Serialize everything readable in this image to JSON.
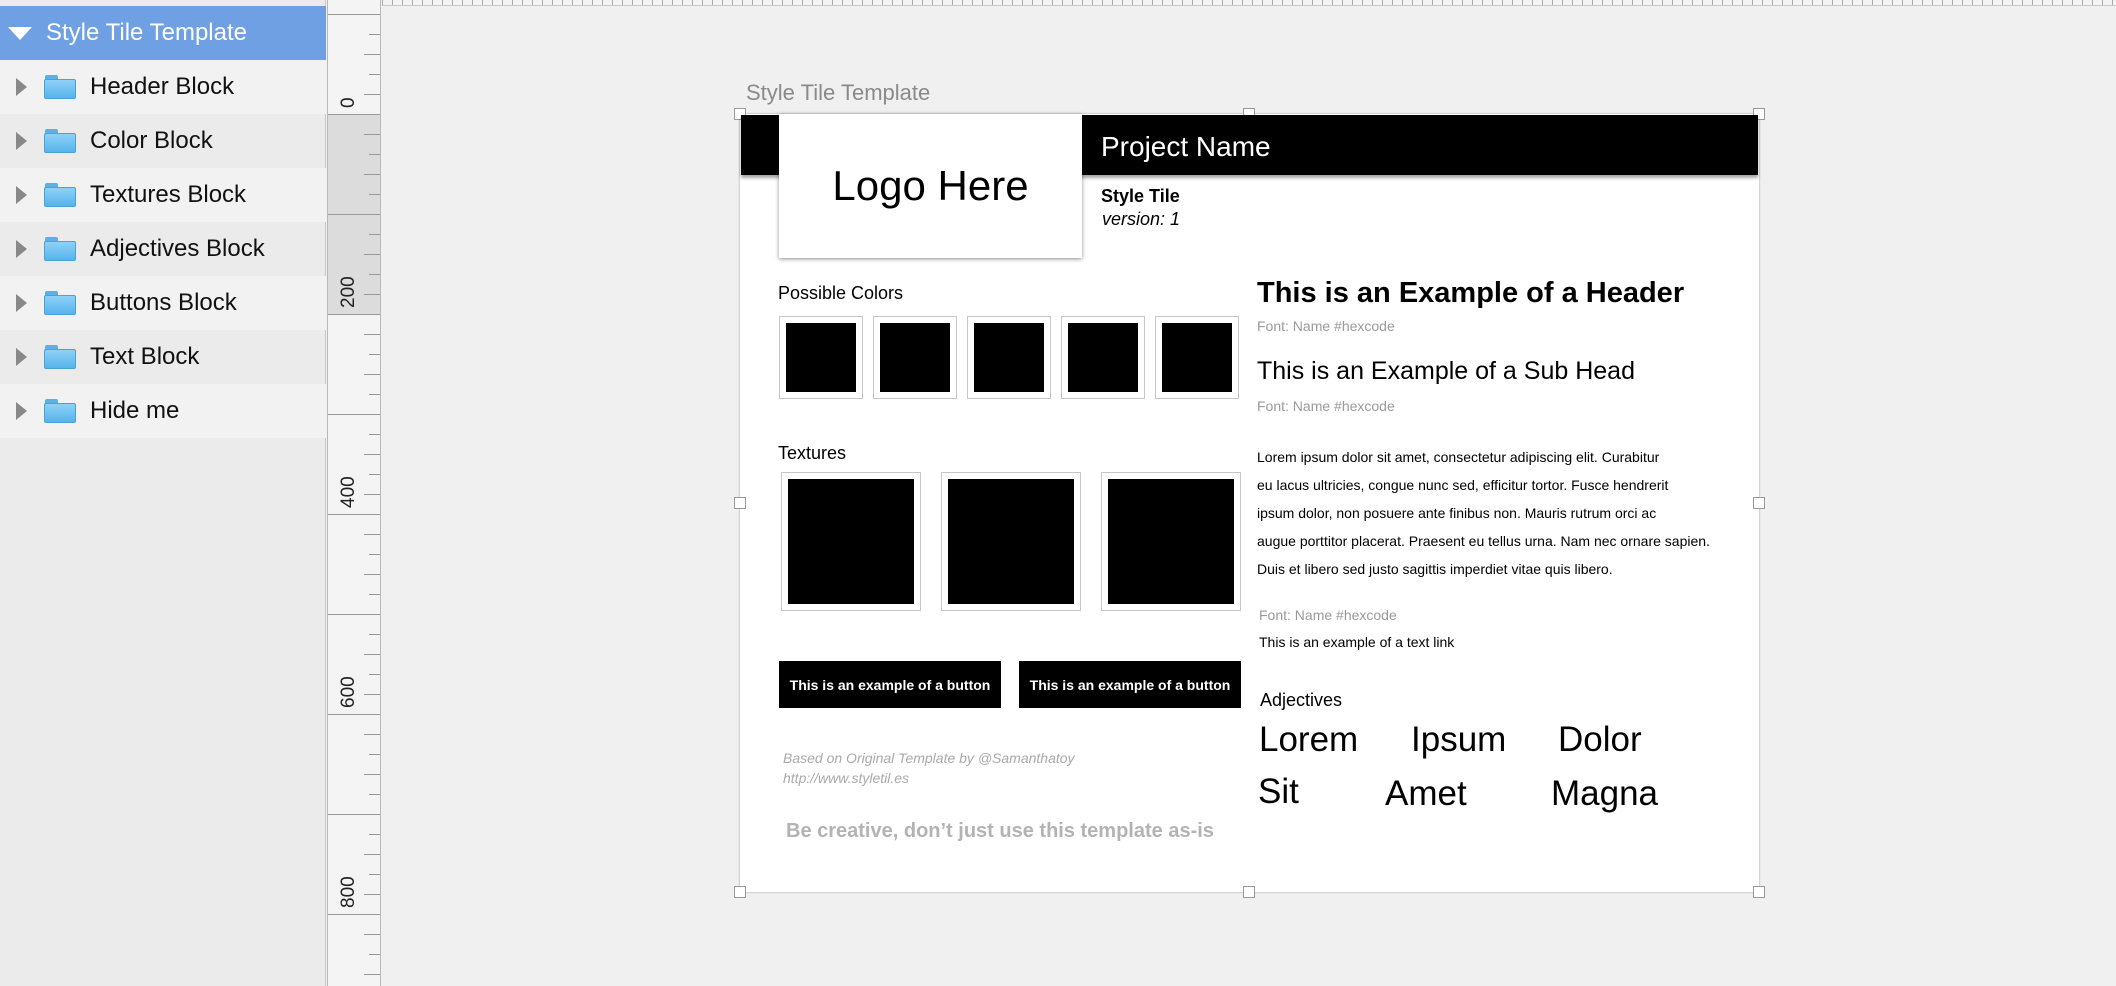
{
  "sidebar": {
    "root_label": "Style Tile Template",
    "items": [
      {
        "label": "Header Block"
      },
      {
        "label": "Color Block"
      },
      {
        "label": "Textures Block"
      },
      {
        "label": "Adjectives Block"
      },
      {
        "label": "Buttons Block"
      },
      {
        "label": "Text Block"
      },
      {
        "label": "Hide me"
      }
    ]
  },
  "ruler": {
    "labels": [
      "0",
      "200",
      "400",
      "600",
      "800"
    ]
  },
  "artboard": {
    "title": "Style Tile Template",
    "project_name": "Project Name",
    "logo_text": "Logo Here",
    "style_tile_label": "Style Tile",
    "version_label": "version: 1",
    "colors_label": "Possible Colors",
    "swatch_colors": [
      "#000000",
      "#000000",
      "#000000",
      "#000000",
      "#000000"
    ],
    "textures_label": "Textures",
    "buttons": [
      "This is an example of a button",
      "This is an example of a button"
    ],
    "credit_line1": "Based on Original Template by @Samanthatoy",
    "credit_line2": "http://www.styletil.es",
    "be_creative": "Be creative, don’t just use this template as-is",
    "header_example": "This is an Example of a Header",
    "header_font": "Font: Name #hexcode",
    "subhead_example": "This is an Example of a Sub Head",
    "subhead_font": "Font: Name #hexcode",
    "body_lines": [
      "Lorem ipsum dolor sit amet, consectetur adipiscing elit. Curabitur",
      "eu lacus ultricies, congue nunc sed, efficitur tortor. Fusce hendrerit",
      "ipsum dolor, non posuere ante finibus non. Mauris rutrum orci ac",
      "augue porttitor placerat. Praesent eu tellus urna. Nam nec ornare sapien.",
      "Duis et libero sed justo sagittis imperdiet vitae quis libero."
    ],
    "link_font": "Font: Name #hexcode",
    "text_link": "This is an example of a text link",
    "adjectives_label": "Adjectives",
    "adjectives": [
      "Lorem",
      "Ipsum",
      "Dolor",
      "Sit",
      "Amet",
      "Magna"
    ]
  },
  "colors": {
    "selection": "#6fa0e3",
    "folder": "#56b4ec"
  }
}
